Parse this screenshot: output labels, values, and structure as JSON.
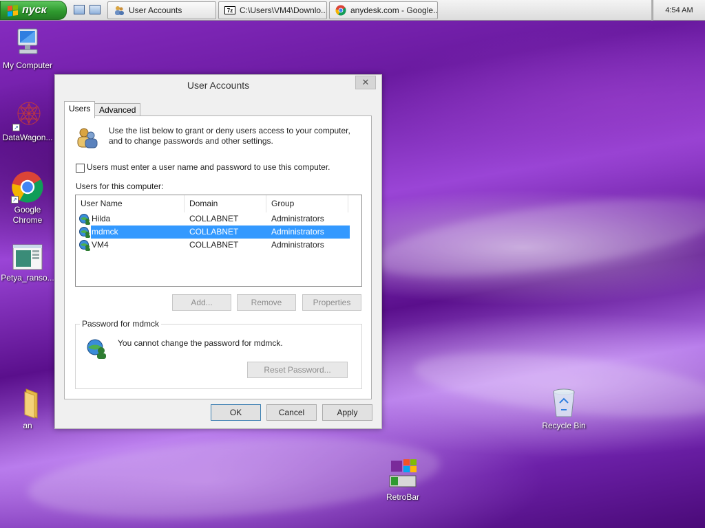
{
  "taskbar": {
    "start_label": "пуск",
    "tasks": [
      {
        "label": "User Accounts",
        "icon": "users-icon"
      },
      {
        "label": "C:\\Users\\VM4\\Downlo...",
        "icon": "7zip-icon"
      },
      {
        "label": "anydesk.com - Google...",
        "icon": "chrome-icon"
      }
    ],
    "clock": "4:54 AM"
  },
  "desktop": {
    "icons": [
      {
        "label": "My Computer",
        "icon": "computer-icon"
      },
      {
        "label": "DataWagon...",
        "icon": "datawagon-icon"
      },
      {
        "label": "Google Chrome",
        "icon": "chrome-icon"
      },
      {
        "label": "Petya_ranso...",
        "icon": "window-icon"
      },
      {
        "label": "an",
        "icon": "folder-icon"
      },
      {
        "label": "Recycle Bin",
        "icon": "recycle-bin-icon"
      },
      {
        "label": "RetroBar",
        "icon": "retrobar-icon"
      }
    ]
  },
  "dialog": {
    "title": "User Accounts",
    "close_glyph": "✕",
    "tabs": [
      {
        "label": "Users",
        "active": true
      },
      {
        "label": "Advanced",
        "active": false
      }
    ],
    "intro": "Use the list below to grant or deny users access to your computer, and to change passwords and other settings.",
    "require_login": {
      "label": "Users must enter a user name and password to use this computer.",
      "checked": false
    },
    "users_caption": "Users for this computer:",
    "columns": [
      "User Name",
      "Domain",
      "Group"
    ],
    "users": [
      {
        "name": "Hilda",
        "domain": "COLLABNET",
        "group": "Administrators",
        "selected": false
      },
      {
        "name": "mdmck",
        "domain": "COLLABNET",
        "group": "Administrators",
        "selected": true
      },
      {
        "name": "VM4",
        "domain": "COLLABNET",
        "group": "Administrators",
        "selected": false
      }
    ],
    "list_buttons": {
      "add": "Add...",
      "remove": "Remove",
      "properties": "Properties"
    },
    "password": {
      "legend": "Password for mdmck",
      "message": "You cannot change the password for mdmck.",
      "reset_button": "Reset Password..."
    },
    "footer": {
      "ok": "OK",
      "cancel": "Cancel",
      "apply": "Apply"
    }
  },
  "colors": {
    "selection": "#3399ff",
    "start_green": "#2f9a2f",
    "desktop_purple": "#7a24b4"
  }
}
